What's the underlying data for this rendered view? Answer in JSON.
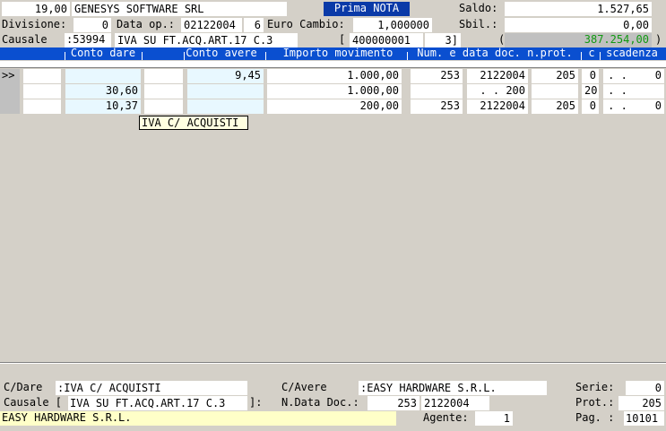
{
  "header": {
    "amount": "19,00",
    "company": "GENESYS SOFTWARE SRL",
    "badge": "Prima NOTA",
    "saldo_label": "Saldo:",
    "saldo_value": "1.527,65",
    "divisione_label": "Divisione:",
    "divisione_value": "0",
    "data_op_label": "Data op.:",
    "data_op_value": "02122004",
    "data_op_suffix": "6",
    "euro_cambio_label": "Euro Cambio:",
    "euro_cambio_value": "1,000000",
    "sbil_label": "Sbil.:",
    "sbil_value": "0,00",
    "causale_label": "Causale",
    "causale_code": ":53994",
    "causale_desc": "IVA SU FT.ACQ.ART.17 C.3",
    "bracket_open": "[",
    "conto_code": "400000001",
    "conto_suffix": "3]",
    "paren_open": "(",
    "total_value": "387.254,00",
    "paren_close": ")"
  },
  "columns": [
    "Conto dare",
    "Conto avere",
    "Importo movimento",
    "Num. e data doc. n.prot.",
    "c",
    "scadenza"
  ],
  "rows": [
    {
      "marker": ">>",
      "dare_code": "",
      "dare_amount": "",
      "avere_code": "",
      "avere_amount": "9,45",
      "importo": "1.000,00",
      "num": "253",
      "data": "2122004",
      "prot": "205",
      "c": "0",
      "scad_mark": ". .",
      "scad": "0"
    },
    {
      "marker": "",
      "dare_code": "",
      "dare_amount": "30,60",
      "avere_code": "",
      "avere_amount": "",
      "importo": "1.000,00",
      "num": "",
      "data": ". . 200",
      "prot": "",
      "c": "20",
      "scad_mark": ". .",
      "scad": ""
    },
    {
      "marker": "",
      "dare_code": "",
      "dare_amount": "10,37",
      "avere_code": "",
      "avere_amount": "",
      "importo": "200,00",
      "num": "253",
      "data": "2122004",
      "prot": "205",
      "c": "0",
      "scad_mark": ". .",
      "scad": "0"
    }
  ],
  "tooltip": "IVA C/ ACQUISTI",
  "footer": {
    "cdare_label": "C/Dare",
    "cdare_value": ":IVA C/ ACQUISTI",
    "cavere_label": "C/Avere",
    "cavere_value": ":EASY HARDWARE S.R.L.",
    "serie_label": "Serie:",
    "serie_value": "0",
    "causale_label": "Causale [",
    "causale_value": "IVA SU FT.ACQ.ART.17 C.3",
    "causale_close": "]:",
    "ndata_label": "N.Data Doc.:",
    "ndata_num": "253",
    "ndata_date": "2122004",
    "prot_label": "Prot.:",
    "prot_value": "205",
    "supplier": "EASY HARDWARE S.R.L.",
    "agente_label": "Agente:",
    "agente_value": "1",
    "pag_label": "Pag. :",
    "pag_value": "10101"
  }
}
